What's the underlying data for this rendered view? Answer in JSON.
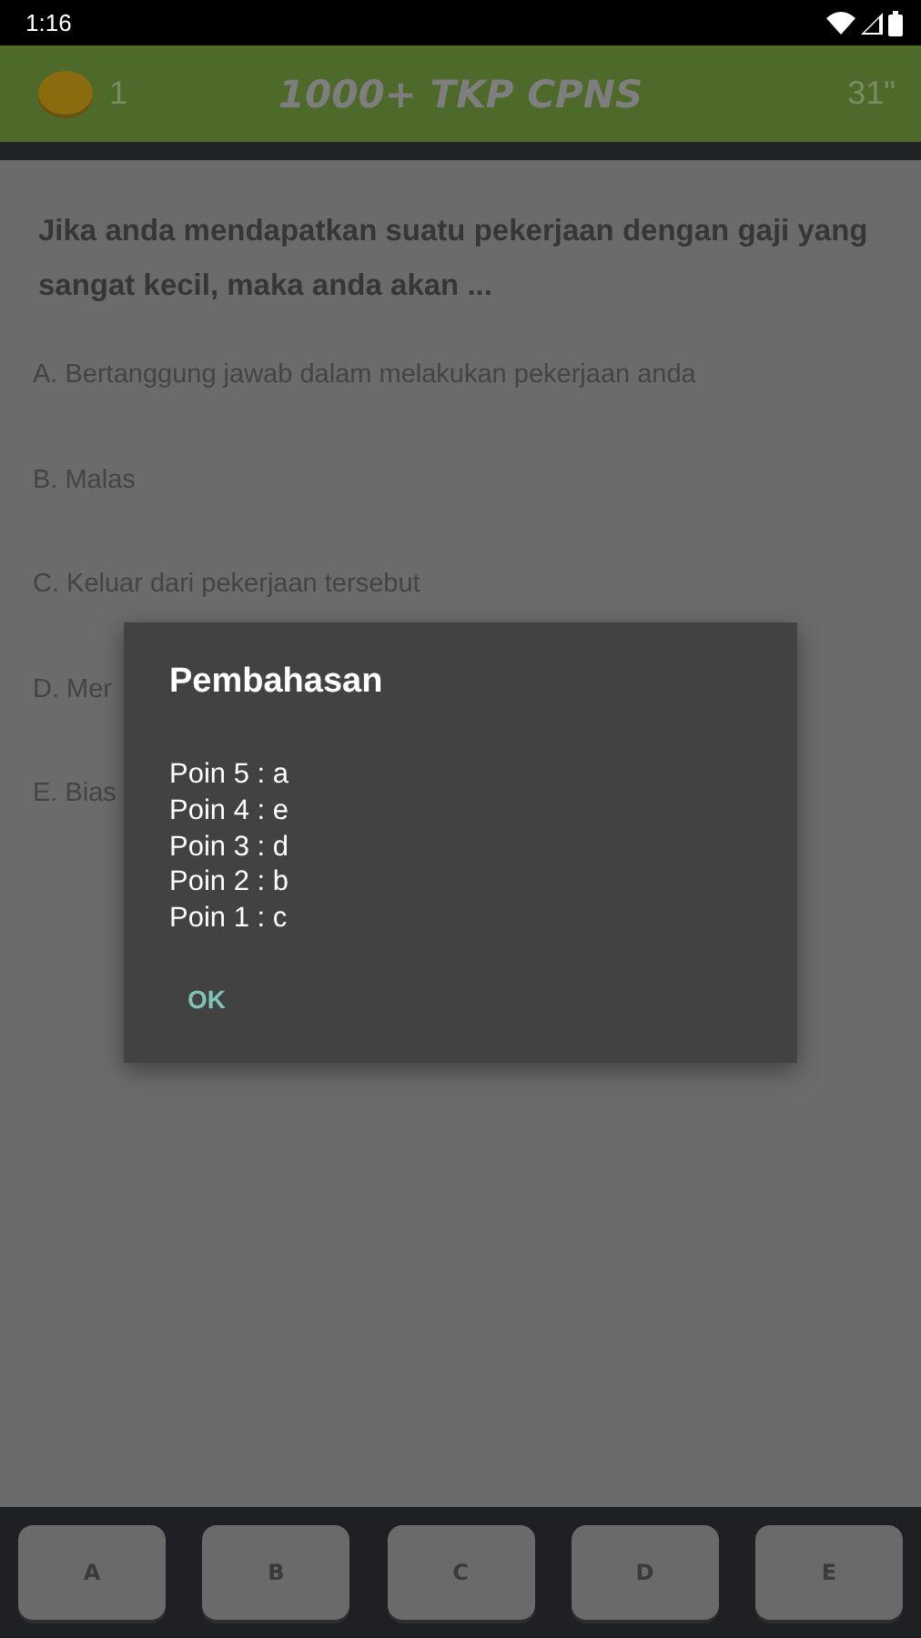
{
  "status_bar": {
    "time": "1:16"
  },
  "header": {
    "coins": "1",
    "title": "1000+ TKP CPNS",
    "timer": "31\""
  },
  "question": "Jika  anda  mendapatkan  suatu  pekerjaan  dengan gaji yang sangat kecil, maka anda  akan ...",
  "options": [
    "A. Bertanggung  jawab  dalam  melakukan  pekerjaan anda",
    "B. Malas",
    "C. Keluar dari pekerjaan tersebut",
    "D. Mer",
    "E. Bias"
  ],
  "dialog": {
    "title": "Pembahasan",
    "lines": [
      "Poin 5 : a",
      "Poin 4 : e",
      "Poin 3 : d",
      "Poin 2 : b",
      "Poin 1 : c"
    ],
    "button": "OK"
  },
  "answer_buttons": [
    "A",
    "B",
    "C",
    "D",
    "E"
  ]
}
